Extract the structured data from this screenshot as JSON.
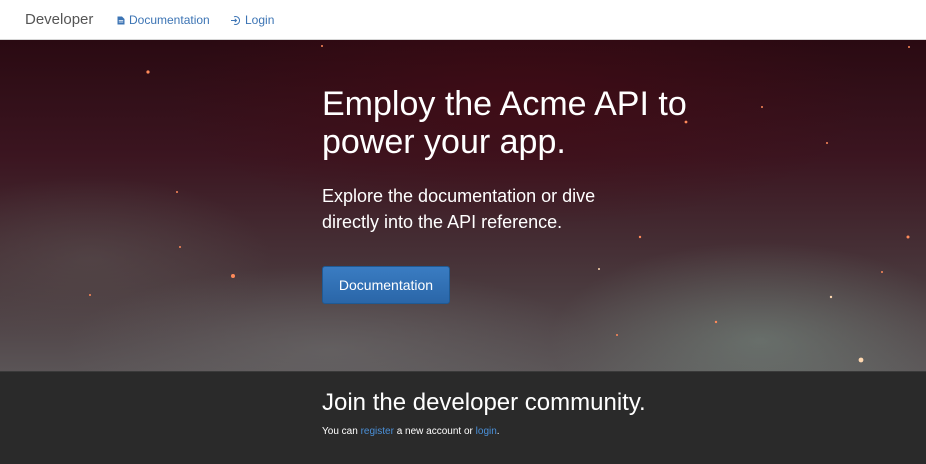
{
  "navbar": {
    "brand": "Developer",
    "links": [
      {
        "label": "Documentation",
        "icon": "document-icon"
      },
      {
        "label": "Login",
        "icon": "login-icon"
      }
    ]
  },
  "hero": {
    "title": "Employ the Acme API to power your app.",
    "subtitle": "Explore the documentation or dive directly into the API reference.",
    "button_label": "Documentation"
  },
  "community": {
    "title": "Join the developer community.",
    "text_prefix": "You can",
    "register_link": "register",
    "text_middle": "a new account or",
    "login_link": "login",
    "text_suffix": "."
  },
  "colors": {
    "link": "#3c74b4",
    "button": "#2a66a8",
    "footer_bg": "#2a2a2a"
  }
}
